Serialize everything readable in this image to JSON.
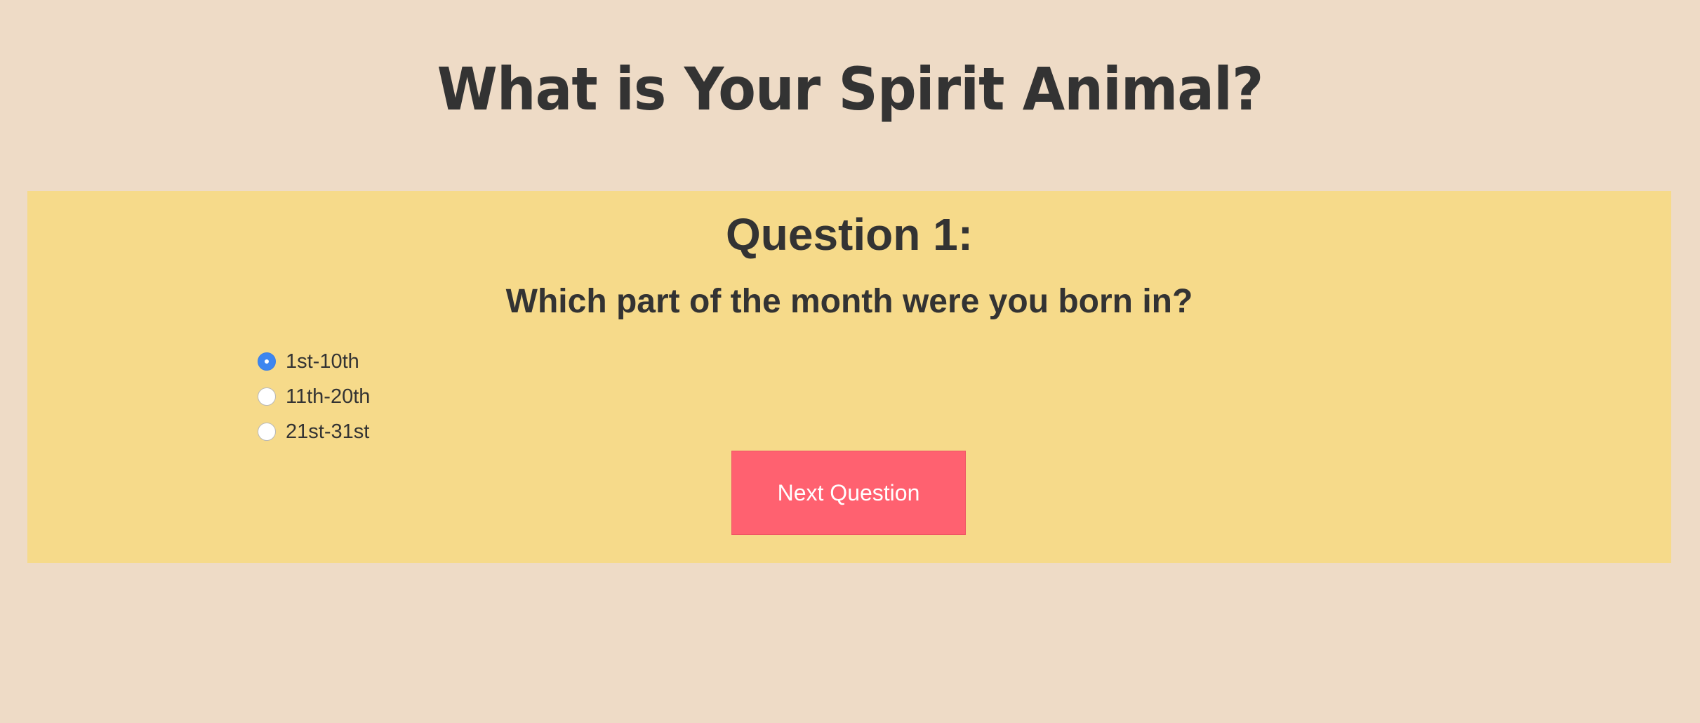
{
  "header": {
    "title": "What is Your Spirit Animal?"
  },
  "quiz": {
    "question_number": "Question 1:",
    "question_text": "Which part of the month were you born in?",
    "options": [
      {
        "label": "1st-10th",
        "selected": true
      },
      {
        "label": "11th-20th",
        "selected": false
      },
      {
        "label": "21st-31st",
        "selected": false
      }
    ],
    "next_button_label": "Next Question"
  },
  "colors": {
    "page_background": "#eedbc6",
    "panel_background": "#f6da8a",
    "button_background": "#ff6170",
    "radio_selected": "#3d86f0",
    "text": "#333333"
  }
}
